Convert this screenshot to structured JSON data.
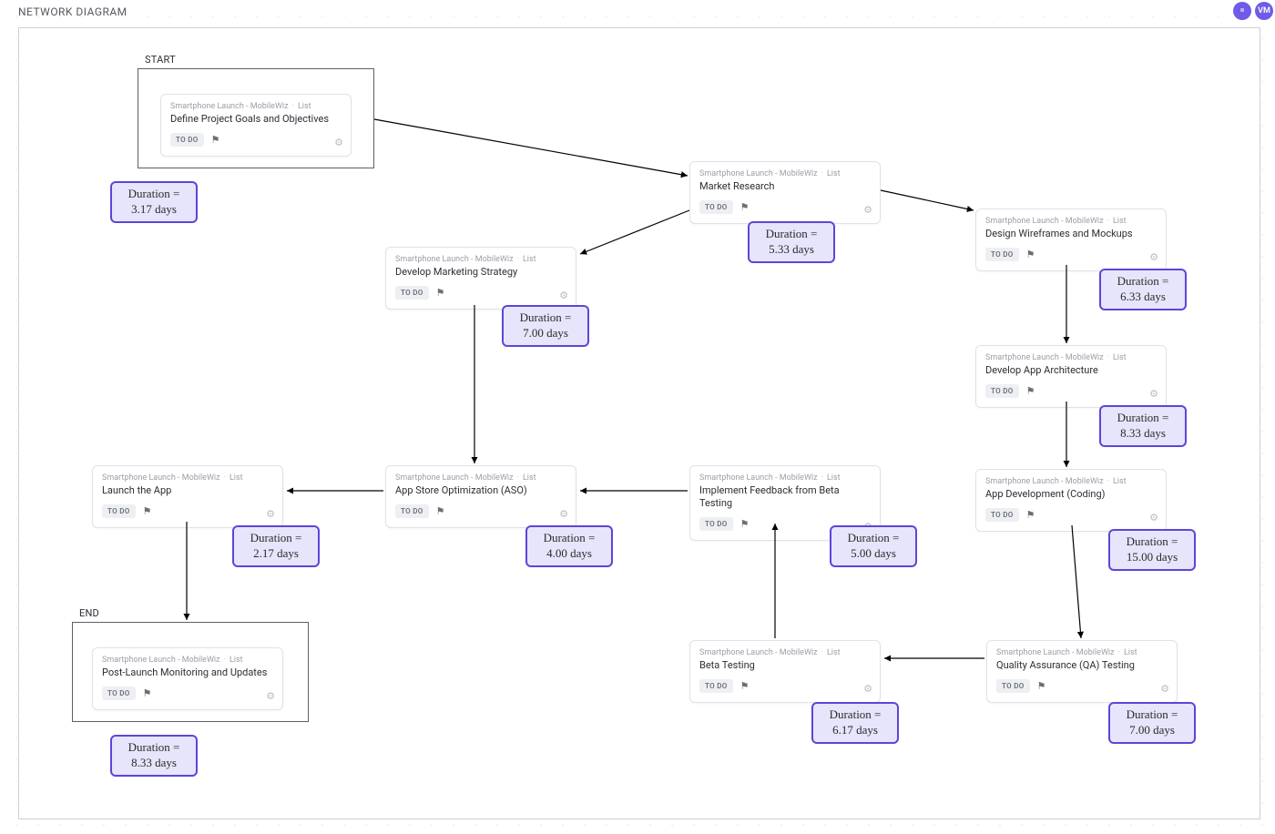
{
  "page_title": "NETWORK DIAGRAM",
  "shelf_badges": [
    "=",
    "VM"
  ],
  "milestones": {
    "start_label": "START",
    "end_label": "END"
  },
  "crumbs": {
    "project": "Smartphone Launch - MobileWiz",
    "list": "List"
  },
  "status": {
    "todo": "TO DO"
  },
  "tasks": {
    "define": {
      "title": "Define Project Goals and Objectives"
    },
    "market": {
      "title": "Market Research"
    },
    "strategy": {
      "title": "Develop Marketing Strategy"
    },
    "wire": {
      "title": "Design Wireframes and Mockups"
    },
    "arch": {
      "title": "Develop App Architecture"
    },
    "dev": {
      "title": "App Development (Coding)"
    },
    "qa": {
      "title": "Quality Assurance (QA) Testing"
    },
    "beta": {
      "title": "Beta Testing"
    },
    "impl": {
      "title": "Implement Feedback from Beta Testing"
    },
    "aso": {
      "title": "App Store Optimization (ASO)"
    },
    "launch": {
      "title": "Launch the App"
    },
    "post": {
      "title": "Post-Launch Monitoring and Updates"
    }
  },
  "durations": {
    "define": {
      "label": "Duration =",
      "value": "3.17 days"
    },
    "market": {
      "label": "Duration =",
      "value": "5.33 days"
    },
    "strategy": {
      "label": "Duration =",
      "value": "7.00 days"
    },
    "wire": {
      "label": "Duration =",
      "value": "6.33 days"
    },
    "arch": {
      "label": "Duration =",
      "value": "8.33 days"
    },
    "dev": {
      "label": "Duration =",
      "value": "15.00 days"
    },
    "qa": {
      "label": "Duration =",
      "value": "7.00 days"
    },
    "beta": {
      "label": "Duration =",
      "value": "6.17 days"
    },
    "impl": {
      "label": "Duration =",
      "value": "5.00 days"
    },
    "aso": {
      "label": "Duration =",
      "value": "4.00 days"
    },
    "launch": {
      "label": "Duration =",
      "value": "2.17 days"
    },
    "post": {
      "label": "Duration =",
      "value": "8.33 days"
    }
  }
}
